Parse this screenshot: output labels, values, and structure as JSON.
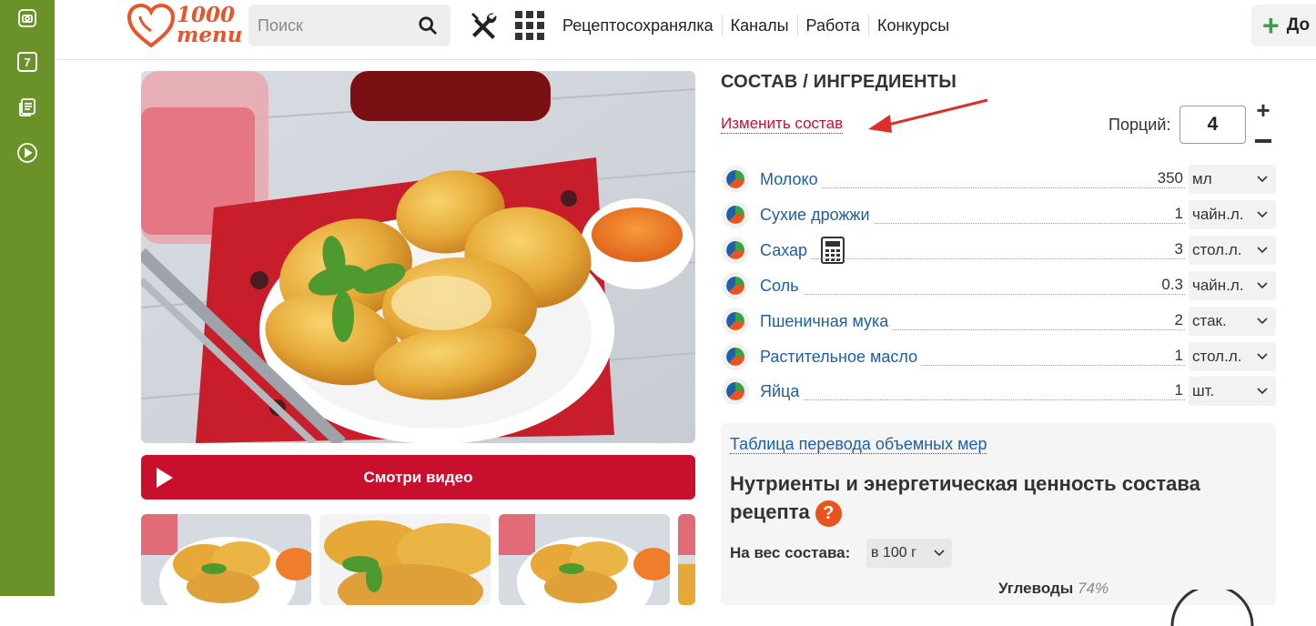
{
  "brand": {
    "logo_text": "1000\nmenu",
    "accent": "#e8542b",
    "rail_color": "#6a9228",
    "video_color": "#c8102e"
  },
  "sidebar": {
    "items": [
      {
        "icon": "camera-square-icon"
      },
      {
        "icon": "calendar-icon",
        "badge": "7"
      },
      {
        "icon": "notes-icon"
      },
      {
        "icon": "play-circle-icon"
      }
    ]
  },
  "header": {
    "search": {
      "placeholder": "Поиск",
      "value": ""
    },
    "nav": [
      "Рецептосохранялка",
      "Каналы",
      "Работа",
      "Конкурсы"
    ],
    "add_button": "До"
  },
  "media": {
    "video_button": "Смотри видео"
  },
  "ingredients": {
    "title": "СОСТАВ / ИНГРЕДИЕНТЫ",
    "edit_link": "Изменить состав",
    "portions_label": "Порций:",
    "portions_value": "4",
    "items": [
      {
        "name": "Молоко",
        "qty": "350",
        "unit": "мл"
      },
      {
        "name": "Сухие дрожжи",
        "qty": "1",
        "unit": "чайн.л."
      },
      {
        "name": "Сахар",
        "qty": "3",
        "unit": "стол.л."
      },
      {
        "name": "Соль",
        "qty": "0.3",
        "unit": "чайн.л."
      },
      {
        "name": "Пшеничная мука",
        "qty": "2",
        "unit": "стак."
      },
      {
        "name": "Растительное масло",
        "qty": "1",
        "unit": "стол.л."
      },
      {
        "name": "Яйца",
        "qty": "1",
        "unit": "шт."
      }
    ]
  },
  "nutrients": {
    "measure_link": "Таблица перевода объемных мер",
    "title": "Нутриенты и энергетическая ценность состава рецепта",
    "help": "?",
    "weight_label": "На вес состава:",
    "weight_value": "в 100 г",
    "carbs_label": "Углеводы",
    "carbs_value": "74%"
  }
}
